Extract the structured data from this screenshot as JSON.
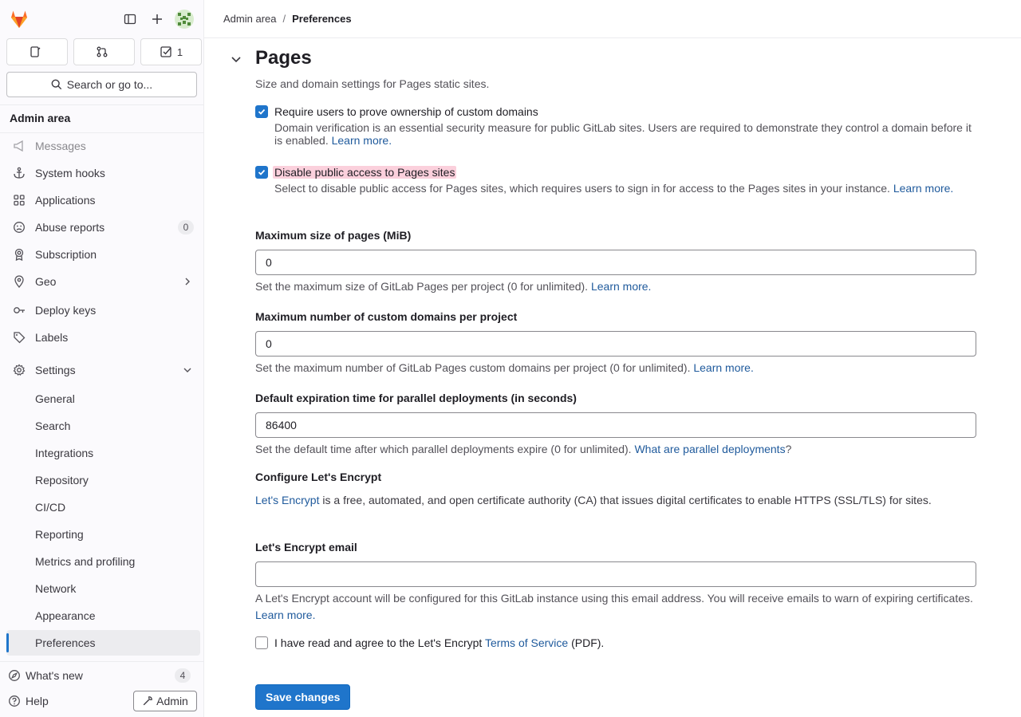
{
  "sidebar": {
    "counters": [
      {
        "icon": "issues-icon",
        "count": ""
      },
      {
        "icon": "merge-request-icon",
        "count": ""
      },
      {
        "icon": "todo-icon",
        "count": "1"
      }
    ],
    "search_label": "Search or go to...",
    "context_title": "Admin area",
    "items": [
      {
        "label": "Messages",
        "icon": "bullhorn-icon"
      },
      {
        "label": "System hooks",
        "icon": "anchor-icon"
      },
      {
        "label": "Applications",
        "icon": "applications-icon"
      },
      {
        "label": "Abuse reports",
        "icon": "abuse-icon",
        "badge": "0"
      },
      {
        "label": "Subscription",
        "icon": "license-icon"
      },
      {
        "label": "Geo",
        "icon": "location-icon"
      },
      {
        "label": "Deploy keys",
        "icon": "key-icon"
      },
      {
        "label": "Labels",
        "icon": "label-icon"
      },
      {
        "label": "Settings",
        "icon": "settings-icon"
      }
    ],
    "settings_sub": [
      "General",
      "Search",
      "Integrations",
      "Repository",
      "CI/CD",
      "Reporting",
      "Metrics and profiling",
      "Network",
      "Appearance",
      "Preferences"
    ],
    "whats_new": "What's new",
    "whats_new_count": "4",
    "help": "Help",
    "admin": "Admin"
  },
  "breadcrumb": {
    "parent": "Admin area",
    "sep": "/",
    "current": "Preferences"
  },
  "section": {
    "title": "Pages",
    "description": "Size and domain settings for Pages static sites."
  },
  "checkbox1": {
    "label": "Require users to prove ownership of custom domains",
    "help": "Domain verification is an essential security measure for public GitLab sites. Users are required to demonstrate they control a domain before it is enabled.",
    "link": "Learn more."
  },
  "checkbox2": {
    "label": "Disable public access to Pages sites",
    "help": "Select to disable public access for Pages sites, which requires users to sign in for access to the Pages sites in your instance.",
    "link": "Learn more."
  },
  "max_size": {
    "label": "Maximum size of pages (MiB)",
    "value": "0",
    "help": "Set the maximum size of GitLab Pages per project (0 for unlimited).",
    "link": "Learn more."
  },
  "max_domains": {
    "label": "Maximum number of custom domains per project",
    "value": "0",
    "help": "Set the maximum number of GitLab Pages custom domains per project (0 for unlimited).",
    "link": "Learn more."
  },
  "expiration": {
    "label": "Default expiration time for parallel deployments (in seconds)",
    "value": "86400",
    "help": "Set the default time after which parallel deployments expire (0 for unlimited).",
    "link": "What are parallel deployments",
    "suffix": "?"
  },
  "letsencrypt": {
    "title": "Configure Let's Encrypt",
    "link": "Let's Encrypt",
    "text": "is a free, automated, and open certificate authority (CA) that issues digital certificates to enable HTTPS (SSL/TLS) for sites."
  },
  "le_email": {
    "label": "Let's Encrypt email",
    "value": "",
    "help": "A Let's Encrypt account will be configured for this GitLab instance using this email address. You will receive emails to warn of expiring certificates.",
    "link": "Learn more."
  },
  "terms": {
    "prefix": "I have read and agree to the Let's Encrypt",
    "link": "Terms of Service",
    "suffix": "(PDF)."
  },
  "save_button": "Save changes"
}
